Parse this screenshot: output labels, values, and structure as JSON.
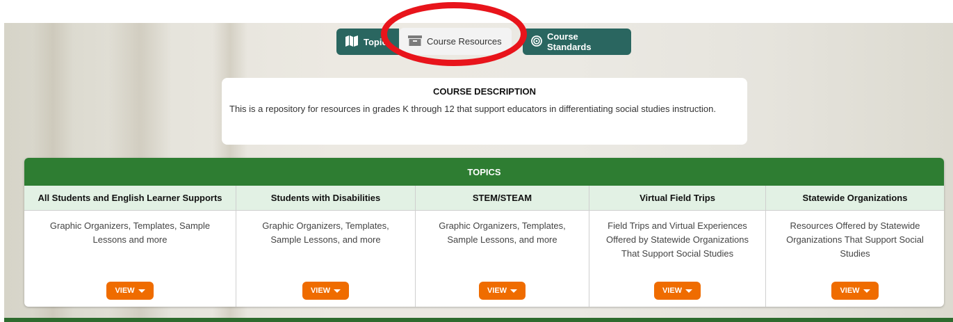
{
  "tabs": {
    "topics_label": "Topics",
    "resources_label": "Course Resources",
    "standards_label": "Course Standards"
  },
  "description": {
    "title": "COURSE DESCRIPTION",
    "text": "This is a repository for resources in grades K through 12 that support educators in differentiating social studies instruction."
  },
  "topics": {
    "header": "TOPICS",
    "columns": [
      {
        "title": "All Students and English Learner Supports",
        "desc": "Graphic Organizers, Templates, Sample Lessons and more",
        "button": "VIEW"
      },
      {
        "title": "Students with Disabilities",
        "desc": "Graphic Organizers, Templates, Sample Lessons, and more",
        "button": "VIEW"
      },
      {
        "title": "STEM/STEAM",
        "desc": "Graphic Organizers, Templates, Sample Lessons, and more",
        "button": "VIEW"
      },
      {
        "title": "Virtual Field Trips",
        "desc": "Field Trips and Virtual Experiences Offered by Statewide Organizations That Support Social Studies",
        "button": "VIEW"
      },
      {
        "title": "Statewide Organizations",
        "desc": "Resources Offered by Statewide Organizations That Support Social Studies",
        "button": "VIEW"
      }
    ]
  },
  "colors": {
    "tab_teal": "#2a6660",
    "header_green": "#2e7d32",
    "subheader_green": "#e2f1e4",
    "button_orange": "#ef6c00",
    "annotation_red": "#e8141b"
  },
  "icons": {
    "topics": "book-map-icon",
    "resources": "archive-box-icon",
    "standards": "target-icon",
    "view_caret": "caret-down-icon"
  }
}
